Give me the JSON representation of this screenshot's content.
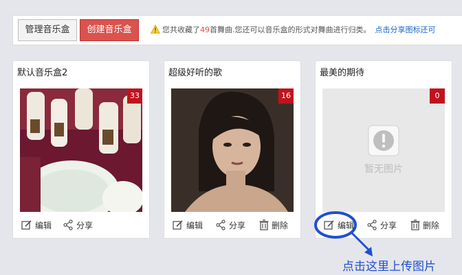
{
  "toolbar": {
    "manage_label": "管理音乐盒",
    "create_label": "创建音乐盒",
    "notice_prefix": "您共收藏了",
    "notice_count": "49",
    "notice_suffix": "首舞曲.您还可以音乐盒的形式对舞曲进行归类。",
    "share_link": "点击分享图标还可"
  },
  "cards": [
    {
      "title": "默认音乐盒2",
      "count": "33",
      "edit": "编辑",
      "share": "分享"
    },
    {
      "title": "超级好听的歌",
      "count": "16",
      "edit": "编辑",
      "share": "分享",
      "delete": "删除"
    },
    {
      "title": "最美的期待",
      "count": "0",
      "placeholder": "暂无图片",
      "edit": "编辑",
      "share": "分享",
      "delete": "删除"
    }
  ],
  "annotation": {
    "text": "点击这里上传图片"
  },
  "colors": {
    "accent_red": "#d9534f",
    "badge_red": "#c1121f",
    "link_blue": "#1a66c8",
    "annotation_blue": "#1f4fd1"
  },
  "icons": [
    "warning-icon",
    "edit-icon",
    "share-icon",
    "trash-icon",
    "exclamation-icon"
  ]
}
